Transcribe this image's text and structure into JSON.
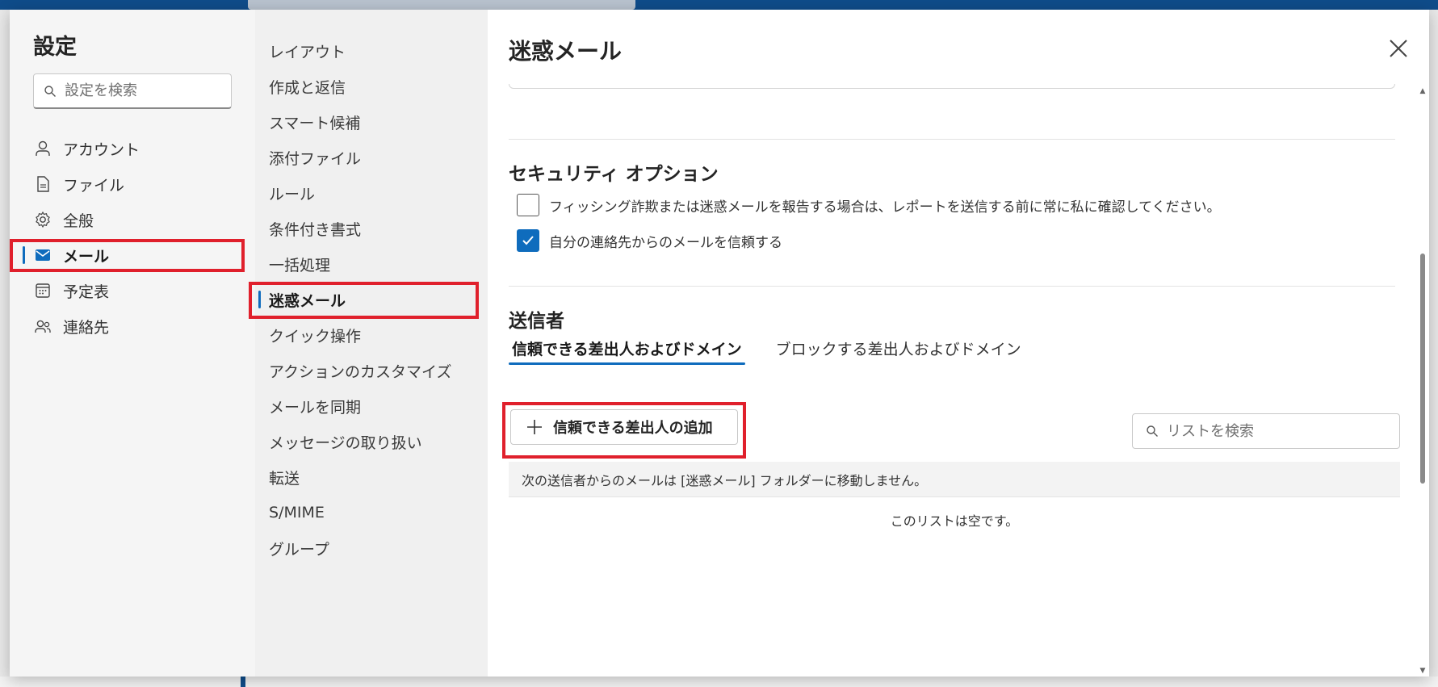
{
  "nav": {
    "title": "設定",
    "search_placeholder": "設定を検索",
    "items": [
      {
        "label": "アカウント",
        "icon": "person-icon"
      },
      {
        "label": "ファイル",
        "icon": "document-icon"
      },
      {
        "label": "全般",
        "icon": "gear-icon"
      },
      {
        "label": "メール",
        "icon": "mail-icon",
        "selected": true
      },
      {
        "label": "予定表",
        "icon": "calendar-icon"
      },
      {
        "label": "連絡先",
        "icon": "people-icon"
      }
    ]
  },
  "subnav": {
    "items": [
      {
        "label": "レイアウト"
      },
      {
        "label": "作成と返信"
      },
      {
        "label": "スマート候補"
      },
      {
        "label": "添付ファイル"
      },
      {
        "label": "ルール"
      },
      {
        "label": "条件付き書式"
      },
      {
        "label": "一括処理"
      },
      {
        "label": "迷惑メール",
        "selected": true
      },
      {
        "label": "クイック操作"
      },
      {
        "label": "アクションのカスタマイズ"
      },
      {
        "label": "メールを同期"
      },
      {
        "label": "メッセージの取り扱い"
      },
      {
        "label": "転送"
      },
      {
        "label": "S/MIME"
      },
      {
        "label": "グループ"
      }
    ]
  },
  "content": {
    "title": "迷惑メール",
    "close_icon": "close-icon",
    "security": {
      "title": "セキュリティ オプション",
      "options": [
        {
          "label": "フィッシング詐欺または迷惑メールを報告する場合は、レポートを送信する前に常に私に確認してください。",
          "checked": false
        },
        {
          "label": "自分の連絡先からのメールを信頼する",
          "checked": true
        }
      ]
    },
    "senders": {
      "title": "送信者",
      "tabs": [
        {
          "label": "信頼できる差出人およびドメイン",
          "selected": true
        },
        {
          "label": "ブロックする差出人およびドメイン",
          "selected": false
        }
      ],
      "add_button": "信頼できる差出人の追加",
      "list_search_placeholder": "リストを検索",
      "info_text": "次の送信者からのメールは [迷惑メール] フォルダーに移動しません。",
      "empty_text": "このリストは空です。"
    }
  },
  "colors": {
    "accent": "#0f6cbd",
    "highlight": "#e0202c"
  }
}
